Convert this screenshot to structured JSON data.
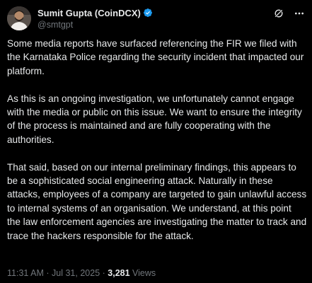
{
  "author": {
    "display_name": "Sumit Gupta (CoinDCX)",
    "handle": "@smtgpt",
    "verified": true,
    "avatar_icon": "profile-photo"
  },
  "icons": {
    "verified": "verified-badge-icon",
    "grok": "grok-icon",
    "more": "more-options-icon"
  },
  "colors": {
    "background": "#000000",
    "text": "#e7e9ea",
    "muted": "#71767b",
    "verified": "#1d9bf0"
  },
  "post": {
    "paragraphs": [
      "Some media reports have surfaced referencing the FIR we filed with the Karnataka Police regarding the security incident that impacted our platform.",
      "As this is an ongoing investigation, we unfortunately cannot engage with the media or public on this issue. We want to ensure the integrity of the process is maintained and are fully cooperating with the authorities.",
      "That said, based on our internal preliminary findings, this appears to be a sophisticated social engineering attack. Naturally in these attacks, employees of a company are targeted to gain unlawful access to internal systems of an organisation. We understand, at this point the law enforcement agencies are investigating the matter to track and trace the hackers responsible for the attack."
    ],
    "time": "11:31 AM",
    "separator": "·",
    "date": "Jul 31, 2025",
    "views_count": "3,281",
    "views_label": "Views"
  }
}
